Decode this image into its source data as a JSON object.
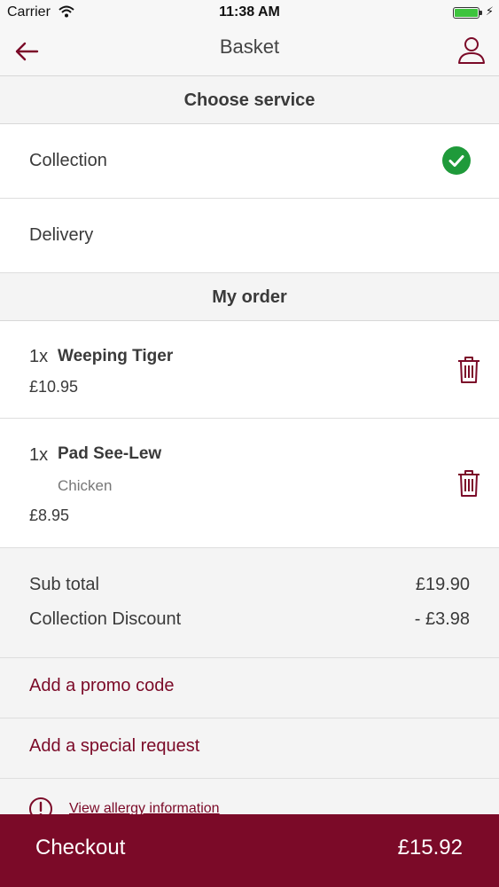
{
  "status_bar": {
    "carrier": "Carrier",
    "time": "11:38 AM",
    "icons": [
      "wifi-icon",
      "battery-icon",
      "charging-bolt-icon"
    ]
  },
  "nav": {
    "title": "Basket",
    "back_icon": "arrow-left-icon",
    "account_icon": "user-icon"
  },
  "service": {
    "header": "Choose service",
    "options": [
      {
        "label": "Collection",
        "selected": true
      },
      {
        "label": "Delivery",
        "selected": false
      }
    ]
  },
  "order": {
    "header": "My order",
    "items": [
      {
        "qty": "1x",
        "name": "Weeping Tiger",
        "variant": "",
        "price": "£10.95"
      },
      {
        "qty": "1x",
        "name": "Pad See-Lew",
        "variant": "Chicken",
        "price": "£8.95"
      }
    ]
  },
  "totals": {
    "subtotal_label": "Sub total",
    "subtotal_value": "£19.90",
    "discount_label": "Collection Discount",
    "discount_value": "- £3.98"
  },
  "links": {
    "promo": "Add a promo code",
    "special_request": "Add a special request",
    "allergy": "View allergy information"
  },
  "checkout": {
    "label": "Checkout",
    "total": "£15.92"
  },
  "colors": {
    "accent": "#7b0a28",
    "check_green": "#1f9a3a",
    "section_bg": "#f4f4f4"
  }
}
